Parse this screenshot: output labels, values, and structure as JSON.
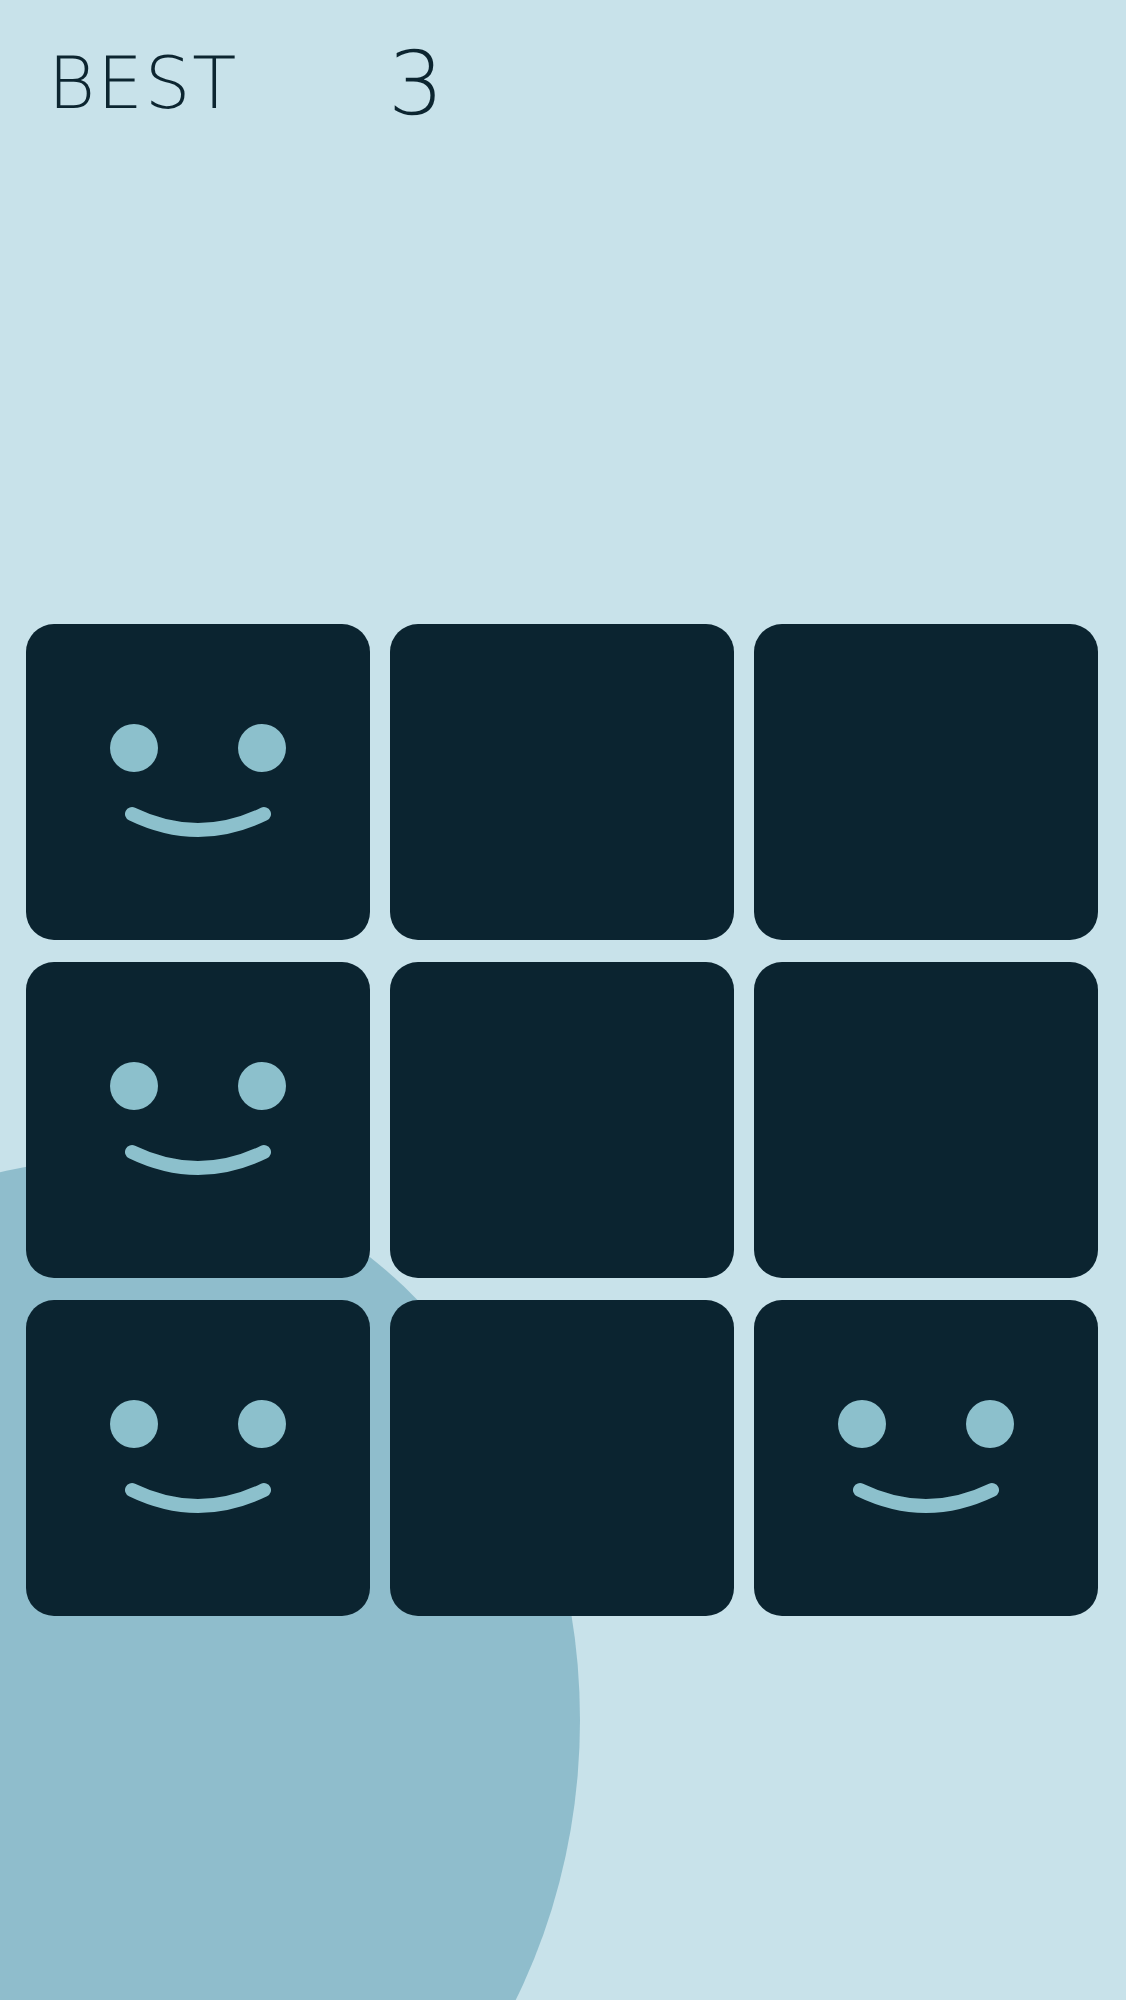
{
  "header": {
    "label": "BEST",
    "score": "3"
  },
  "tiles": [
    {
      "smiley": true
    },
    {
      "smiley": false
    },
    {
      "smiley": false
    },
    {
      "smiley": true
    },
    {
      "smiley": false
    },
    {
      "smiley": false
    },
    {
      "smiley": true
    },
    {
      "smiley": false
    },
    {
      "smiley": true
    }
  ]
}
